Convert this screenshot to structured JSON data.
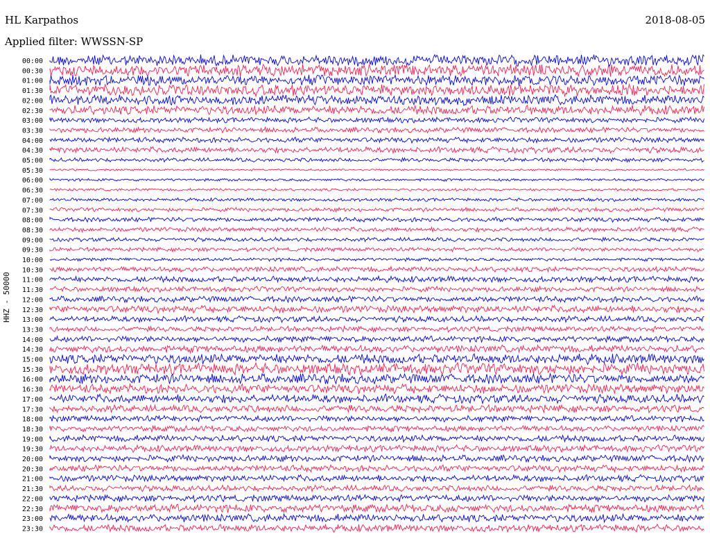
{
  "header": {
    "station": "HL Karpathos",
    "date": "2018-08-05",
    "filter": "Applied filter: WWSSN-SP",
    "channel": "HHZ - 50000"
  },
  "chart_data": {
    "type": "line",
    "title": "",
    "ylabel": "HHZ - 50000",
    "row_interval_minutes": 30,
    "colors": [
      "#0000ff",
      "#ff1a4d"
    ],
    "rows": [
      {
        "time": "00:00",
        "amplitude": 0.85
      },
      {
        "time": "00:30",
        "amplitude": 0.9
      },
      {
        "time": "01:00",
        "amplitude": 0.8
      },
      {
        "time": "01:30",
        "amplitude": 0.85
      },
      {
        "time": "02:00",
        "amplitude": 0.75
      },
      {
        "time": "02:30",
        "amplitude": 0.7
      },
      {
        "time": "03:00",
        "amplitude": 0.4
      },
      {
        "time": "03:30",
        "amplitude": 0.4
      },
      {
        "time": "04:00",
        "amplitude": 0.4
      },
      {
        "time": "04:30",
        "amplitude": 0.45
      },
      {
        "time": "05:00",
        "amplitude": 0.3
      },
      {
        "time": "05:30",
        "amplitude": 0.15
      },
      {
        "time": "06:00",
        "amplitude": 0.2
      },
      {
        "time": "06:30",
        "amplitude": 0.2
      },
      {
        "time": "07:00",
        "amplitude": 0.25
      },
      {
        "time": "07:30",
        "amplitude": 0.3
      },
      {
        "time": "08:00",
        "amplitude": 0.35
      },
      {
        "time": "08:30",
        "amplitude": 0.35
      },
      {
        "time": "09:00",
        "amplitude": 0.3
      },
      {
        "time": "09:30",
        "amplitude": 0.3
      },
      {
        "time": "10:00",
        "amplitude": 0.25
      },
      {
        "time": "10:30",
        "amplitude": 0.4
      },
      {
        "time": "11:00",
        "amplitude": 0.45
      },
      {
        "time": "11:30",
        "amplitude": 0.4
      },
      {
        "time": "12:00",
        "amplitude": 0.45
      },
      {
        "time": "12:30",
        "amplitude": 0.55
      },
      {
        "time": "13:00",
        "amplitude": 0.45
      },
      {
        "time": "13:30",
        "amplitude": 0.4
      },
      {
        "time": "14:00",
        "amplitude": 0.45
      },
      {
        "time": "14:30",
        "amplitude": 0.55
      },
      {
        "time": "15:00",
        "amplitude": 0.75
      },
      {
        "time": "15:30",
        "amplitude": 0.85
      },
      {
        "time": "16:00",
        "amplitude": 0.75
      },
      {
        "time": "16:30",
        "amplitude": 0.7
      },
      {
        "time": "17:00",
        "amplitude": 0.65
      },
      {
        "time": "17:30",
        "amplitude": 0.55
      },
      {
        "time": "18:00",
        "amplitude": 0.45
      },
      {
        "time": "18:30",
        "amplitude": 0.45
      },
      {
        "time": "19:00",
        "amplitude": 0.5
      },
      {
        "time": "19:30",
        "amplitude": 0.5
      },
      {
        "time": "20:00",
        "amplitude": 0.5
      },
      {
        "time": "20:30",
        "amplitude": 0.5
      },
      {
        "time": "21:00",
        "amplitude": 0.5
      },
      {
        "time": "21:30",
        "amplitude": 0.45
      },
      {
        "time": "22:00",
        "amplitude": 0.5
      },
      {
        "time": "22:30",
        "amplitude": 0.6
      },
      {
        "time": "23:00",
        "amplitude": 0.6
      },
      {
        "time": "23:30",
        "amplitude": 0.55
      }
    ]
  }
}
